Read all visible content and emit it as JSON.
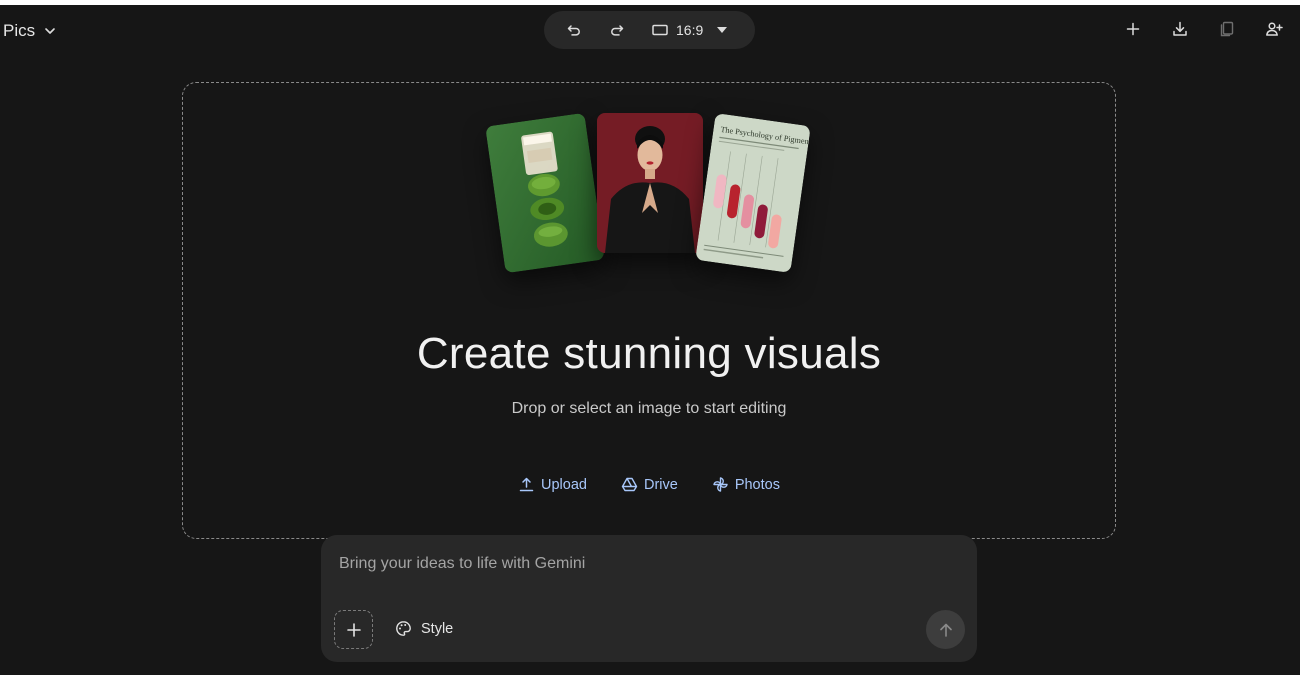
{
  "app": {
    "name": "Pics"
  },
  "toolbar": {
    "aspect_ratio": "16:9"
  },
  "header_icons": [
    "add-icon",
    "download-icon",
    "copy-icon",
    "share-person-icon"
  ],
  "dropzone": {
    "headline": "Create stunning visuals",
    "subtitle": "Drop or select an image to start editing",
    "sources": [
      {
        "label": "Upload",
        "icon": "upload-icon"
      },
      {
        "label": "Drive",
        "icon": "drive-icon"
      },
      {
        "label": "Photos",
        "icon": "photos-icon"
      }
    ],
    "card_right_title": "The Psychology of Pigment"
  },
  "prompt": {
    "placeholder": "Bring your ideas to life with Gemini",
    "style_label": "Style"
  },
  "colors": {
    "background": "#161616",
    "surface": "#282828",
    "link": "#a8c7fa",
    "send_button": "#3d3d3d"
  }
}
